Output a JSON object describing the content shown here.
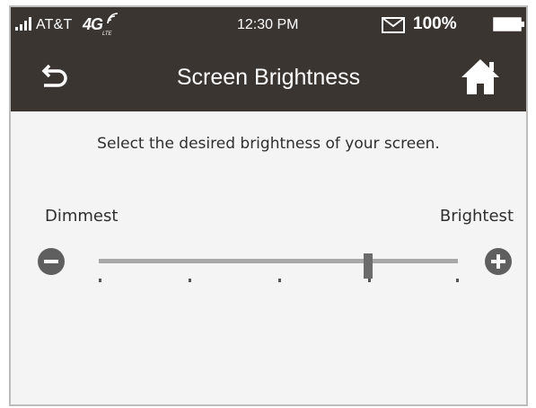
{
  "status_bar": {
    "carrier": "AT&T",
    "network": "4G",
    "network_sub": "LTE",
    "time": "12:30 PM",
    "battery": "100%"
  },
  "header": {
    "title": "Screen Brightness",
    "back_icon": "back-arrow-icon",
    "home_icon": "home-icon"
  },
  "content": {
    "instruction": "Select the desired brightness of your screen.",
    "min_label": "Dimmest",
    "max_label": "Brightest"
  },
  "slider": {
    "level": 0.75,
    "steps": 5
  },
  "colors": {
    "header_bg": "#3b3531",
    "content_bg": "#f4f4f4",
    "control_gray": "#5f5f5f"
  }
}
